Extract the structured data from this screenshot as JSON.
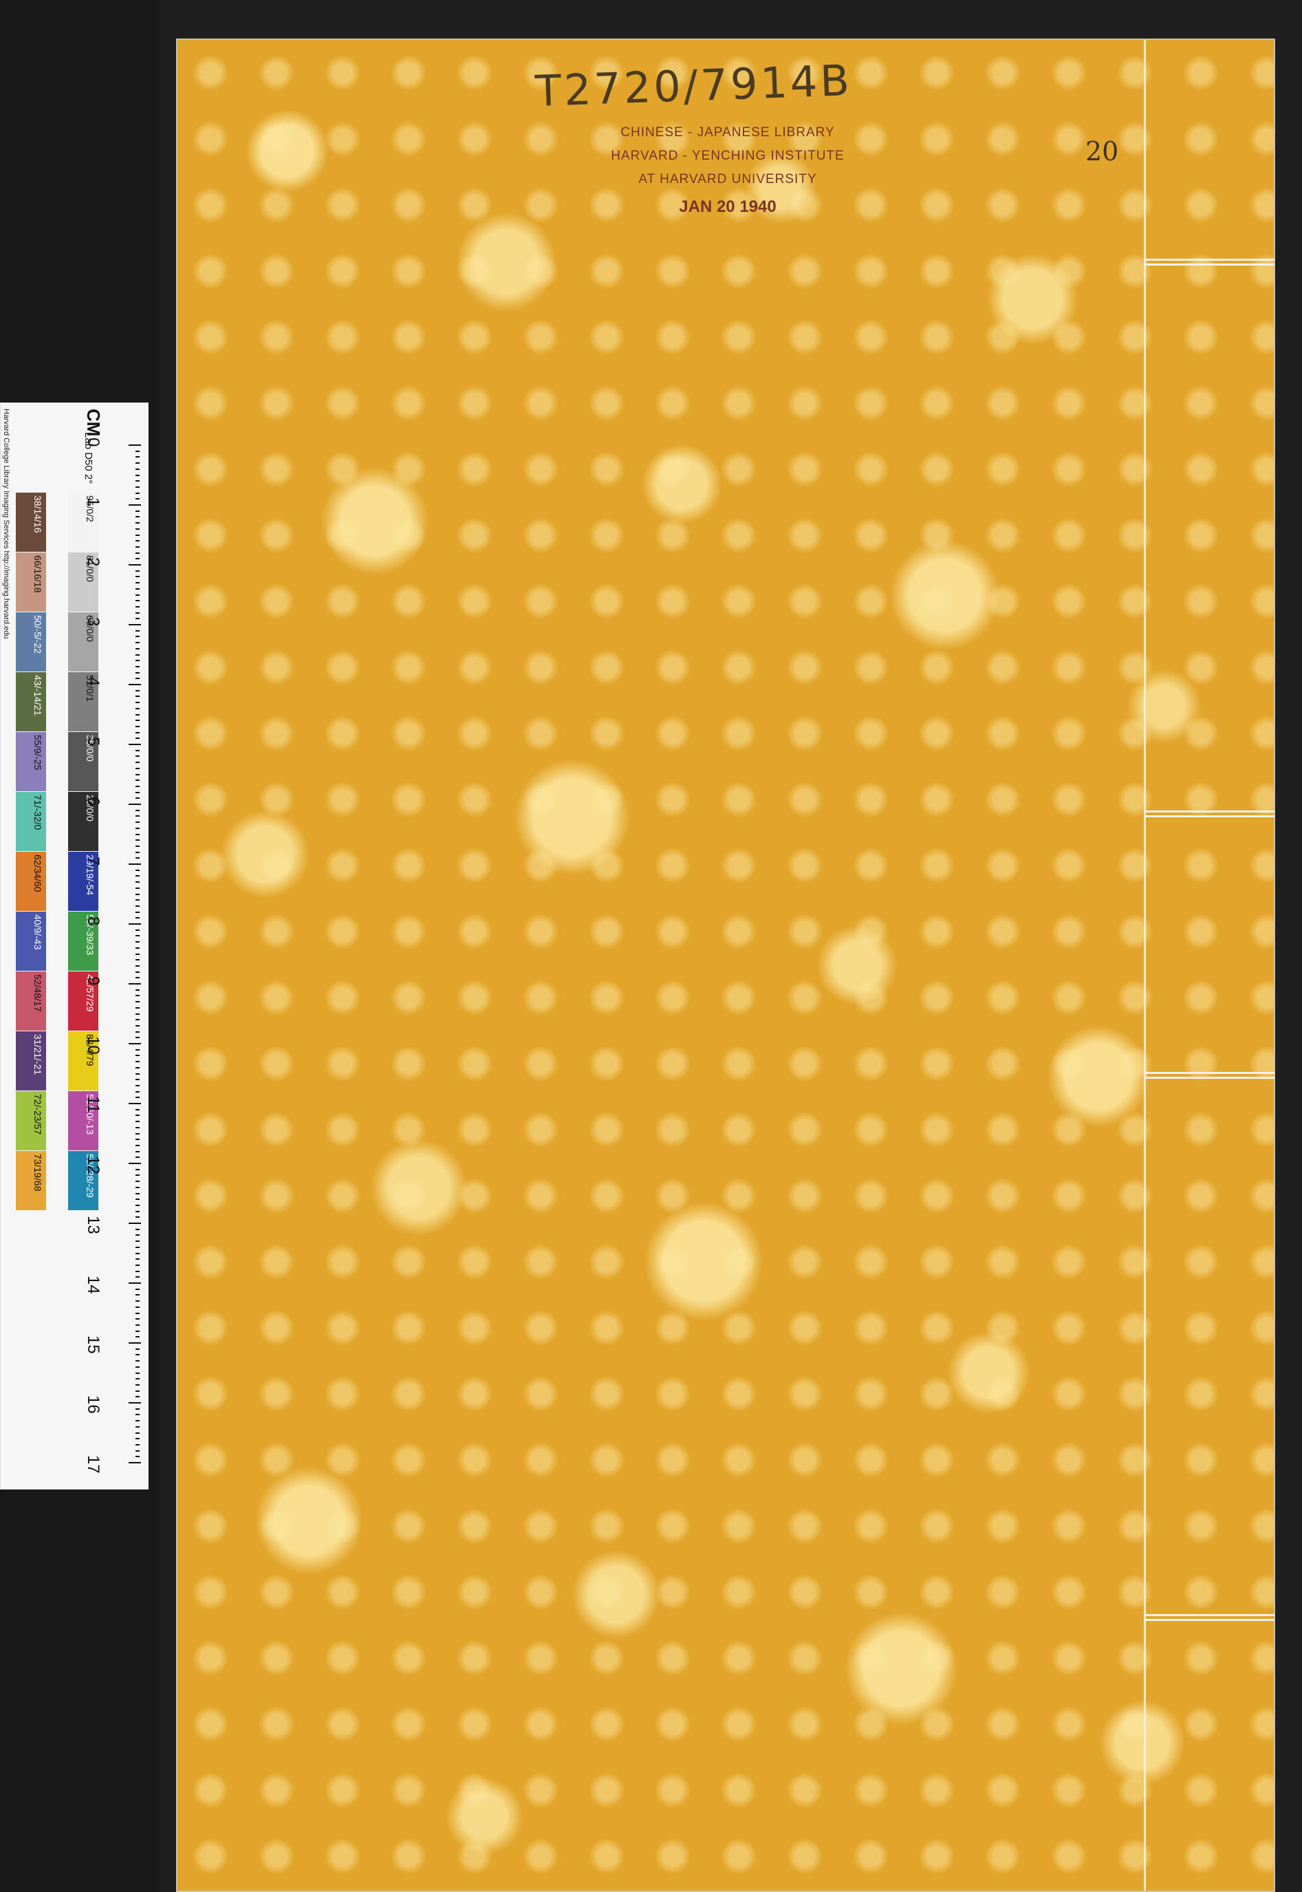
{
  "ruler": {
    "label": "CM",
    "sub": "Lab D50 2°",
    "credit": "Harvard College Library Imaging Services http://imaging.harvard.edu",
    "cm_marks": [
      "0",
      "1",
      "2",
      "3",
      "4",
      "5",
      "6",
      "7",
      "8",
      "9",
      "10",
      "11",
      "12",
      "13",
      "14",
      "15",
      "16",
      "17"
    ]
  },
  "patches_gray": [
    {
      "label": "95/0/2",
      "color": "#f2f2f2"
    },
    {
      "label": "81/0/0",
      "color": "#cccccc"
    },
    {
      "label": "66/0/0",
      "color": "#a6a6a6"
    },
    {
      "label": "51/0/1",
      "color": "#7f7f7f"
    },
    {
      "label": "35/0/0",
      "color": "#575757"
    },
    {
      "label": "20/0/0",
      "color": "#303030"
    },
    {
      "label": "29/19/-54",
      "color": "#2b3da0"
    },
    {
      "label": "55/-39/33",
      "color": "#3e9b4a"
    },
    {
      "label": "42/57/29",
      "color": "#c8293b"
    },
    {
      "label": "82/4/79",
      "color": "#e8cc1a"
    },
    {
      "label": "51/50/-13",
      "color": "#b54ea0"
    },
    {
      "label": "50/-28/-29",
      "color": "#1f86b0"
    }
  ],
  "patches_color": [
    {
      "label": "38/14/16",
      "color": "#6b4a3c"
    },
    {
      "label": "66/16/18",
      "color": "#c69682"
    },
    {
      "label": "50/-5/-22",
      "color": "#5e7ca6"
    },
    {
      "label": "43/-14/21",
      "color": "#5b6e42"
    },
    {
      "label": "55/9/-25",
      "color": "#8a7fba"
    },
    {
      "label": "71/-32/0",
      "color": "#5ec1ad"
    },
    {
      "label": "62/34/60",
      "color": "#dd7c2a"
    },
    {
      "label": "40/9/-43",
      "color": "#4a59ae"
    },
    {
      "label": "52/48/17",
      "color": "#c9576a"
    },
    {
      "label": "31/21/-21",
      "color": "#5b3f78"
    },
    {
      "label": "72/-23/57",
      "color": "#9fc23f"
    },
    {
      "label": "73/19/68",
      "color": "#e6a535"
    }
  ],
  "book": {
    "call_number": "T2720/7914B",
    "stamp_lines": [
      "CHINESE - JAPANESE LIBRARY",
      "HARVARD - YENCHING INSTITUTE",
      "AT HARVARD UNIVERSITY"
    ],
    "stamp_date": "JAN 20 1940",
    "volume_number": "20"
  }
}
